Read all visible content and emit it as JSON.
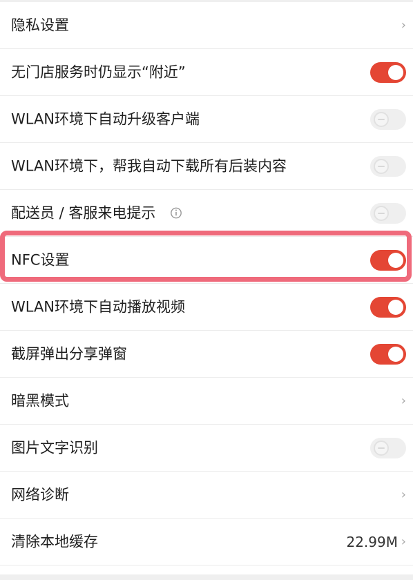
{
  "settings": {
    "items": [
      {
        "label": "隐私设置",
        "control": "chevron"
      },
      {
        "label": "无门店服务时仍显示“附近”",
        "control": "toggle",
        "state": "on"
      },
      {
        "label": "WLAN环境下自动升级客户端",
        "control": "toggle",
        "state": "off"
      },
      {
        "label": "WLAN环境下，帮我自动下载所有后装内容",
        "control": "toggle",
        "state": "off"
      },
      {
        "label": "配送员 / 客服来电提示",
        "control": "toggle",
        "state": "off",
        "icon": "info-icon"
      },
      {
        "label": "NFC设置",
        "control": "toggle",
        "state": "on"
      },
      {
        "label": "WLAN环境下自动播放视频",
        "control": "toggle",
        "state": "on"
      },
      {
        "label": "截屏弹出分享弹窗",
        "control": "toggle",
        "state": "on"
      },
      {
        "label": "暗黑模式",
        "control": "chevron"
      },
      {
        "label": "图片文字识别",
        "control": "toggle",
        "state": "off"
      },
      {
        "label": "网络诊断",
        "control": "chevron"
      },
      {
        "label": "清除本地缓存",
        "control": "chevron",
        "value": "22.99M"
      }
    ],
    "chevron_symbol": "›",
    "highlighted_item": "NFC设置"
  },
  "colors": {
    "toggle_on": "#e44634",
    "toggle_off": "#efefef",
    "highlight_border": "#ef6a7b",
    "text_primary": "#1f1f1f"
  }
}
